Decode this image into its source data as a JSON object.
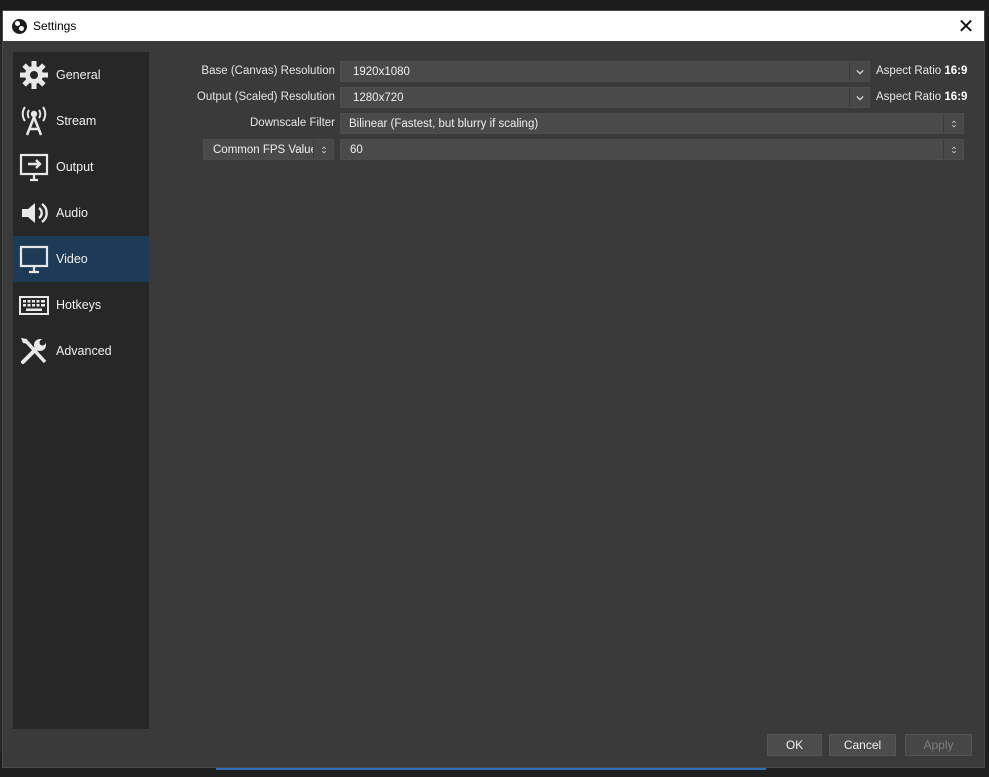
{
  "window": {
    "title": "Settings",
    "close_glyph": "✕"
  },
  "sidebar": {
    "items": [
      {
        "label": "General",
        "icon": "gear-icon"
      },
      {
        "label": "Stream",
        "icon": "broadcast-tower-icon"
      },
      {
        "label": "Output",
        "icon": "output-monitor-icon"
      },
      {
        "label": "Audio",
        "icon": "speaker-icon"
      },
      {
        "label": "Video",
        "icon": "monitor-icon",
        "active": true
      },
      {
        "label": "Hotkeys",
        "icon": "keyboard-icon"
      },
      {
        "label": "Advanced",
        "icon": "wrench-screwdriver-icon"
      }
    ]
  },
  "video": {
    "base_resolution": {
      "label": "Base (Canvas) Resolution",
      "value": "1920x1080",
      "aspect_label": "Aspect Ratio",
      "aspect_value": "16:9"
    },
    "output_resolution": {
      "label": "Output (Scaled) Resolution",
      "value": "1280x720",
      "aspect_label": "Aspect Ratio",
      "aspect_value": "16:9"
    },
    "downscale_filter": {
      "label": "Downscale Filter",
      "value": "Bilinear (Fastest, but blurry if scaling)"
    },
    "fps": {
      "mode": "Common FPS Values",
      "value": "60"
    }
  },
  "footer": {
    "ok": "OK",
    "cancel": "Cancel",
    "apply": "Apply"
  },
  "colors": {
    "active_nav": "#1d3b56",
    "dialog_bg": "#3a3a3a",
    "sidebar_bg": "#272727"
  }
}
